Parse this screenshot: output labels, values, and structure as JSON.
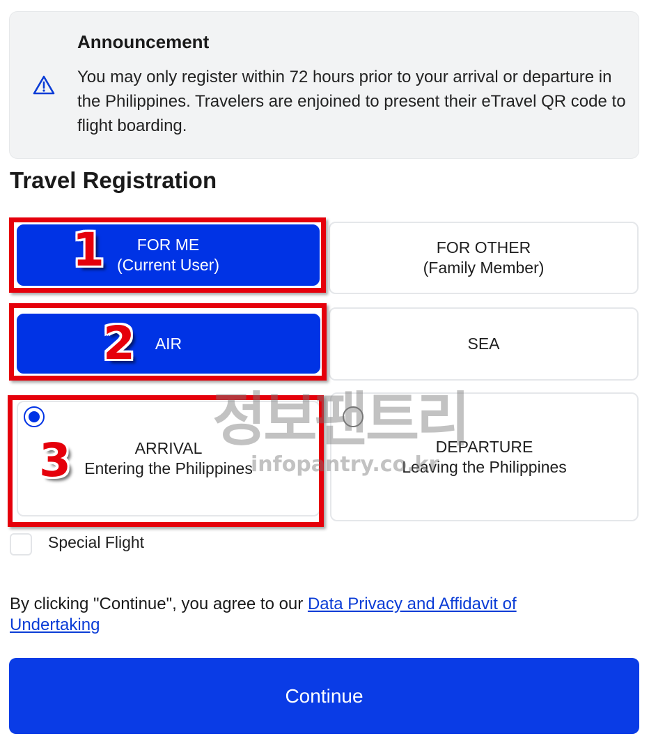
{
  "announcement": {
    "icon": "warning-triangle-icon",
    "title": "Announcement",
    "body": "You may only register within 72 hours prior to your arrival or departure in the Philippines. Travelers are enjoined to present their eTravel QR code to flight boarding."
  },
  "page_title": "Travel Registration",
  "registrant": {
    "for_me": {
      "line1": "FOR ME",
      "line2": "(Current User)",
      "selected": true
    },
    "for_other": {
      "line1": "FOR OTHER",
      "line2": "(Family Member)",
      "selected": false
    }
  },
  "mode": {
    "air": {
      "label": "AIR",
      "selected": true
    },
    "sea": {
      "label": "SEA",
      "selected": false
    }
  },
  "direction": {
    "arrival": {
      "label": "ARRIVAL",
      "sublabel": "Entering the Philippines",
      "selected": true
    },
    "departure": {
      "label": "DEPARTURE",
      "sublabel": "Leaving the Philippines",
      "selected": false
    }
  },
  "special_flight": {
    "label": "Special Flight",
    "checked": false
  },
  "consent": {
    "prefix": "By clicking \"Continue\", you agree to our ",
    "link": "Data Privacy and Affidavit of Undertaking"
  },
  "continue_label": "Continue",
  "annotations": {
    "step1": "1",
    "step2": "2",
    "step3": "3"
  },
  "watermark": {
    "korean": "정보팬트리",
    "domain": "infopantry.co.kr"
  },
  "colors": {
    "primary": "#0033e5",
    "annotation_red": "#e5000b",
    "announcement_bg": "#f2f3f4"
  }
}
